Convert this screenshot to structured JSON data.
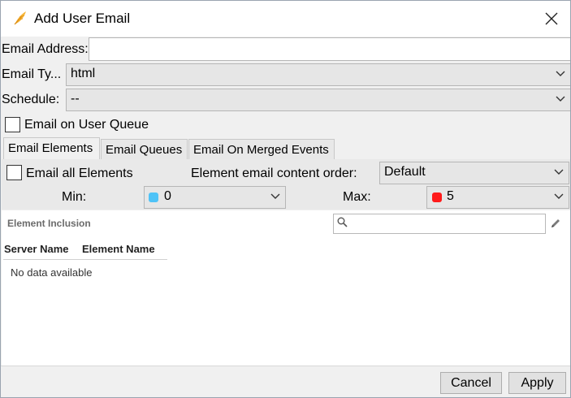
{
  "window": {
    "title": "Add User Email"
  },
  "form": {
    "email_address_label": "Email Address:",
    "email_address_value": "",
    "email_type_label": "Email Ty...",
    "email_type_value": "html",
    "schedule_label": "Schedule:",
    "schedule_value": "--",
    "email_on_user_queue_label": "Email on User Queue",
    "email_on_user_queue_checked": false
  },
  "tabs": [
    {
      "label": "Email Elements",
      "active": true
    },
    {
      "label": "Email Queues",
      "active": false
    },
    {
      "label": "Email On Merged Events",
      "active": false
    }
  ],
  "elements_tab": {
    "email_all_elements_label": "Email all Elements",
    "email_all_elements_checked": false,
    "content_order_label": "Element email content order:",
    "content_order_value": "Default",
    "min_label": "Min:",
    "min_value": "0",
    "min_color": "#4fc3f7",
    "max_label": "Max:",
    "max_value": "5",
    "max_color": "#ff1a1a",
    "inclusion_title": "Element Inclusion",
    "search_value": "",
    "table": {
      "columns": [
        "Server Name",
        "Element Name"
      ],
      "empty_text": "No data available"
    }
  },
  "footer": {
    "cancel_label": "Cancel",
    "apply_label": "Apply"
  },
  "icons": {
    "app": "feather-icon",
    "close": "close-icon",
    "dropdown": "chevron-down-icon",
    "search": "search-icon",
    "edit": "pencil-icon"
  }
}
